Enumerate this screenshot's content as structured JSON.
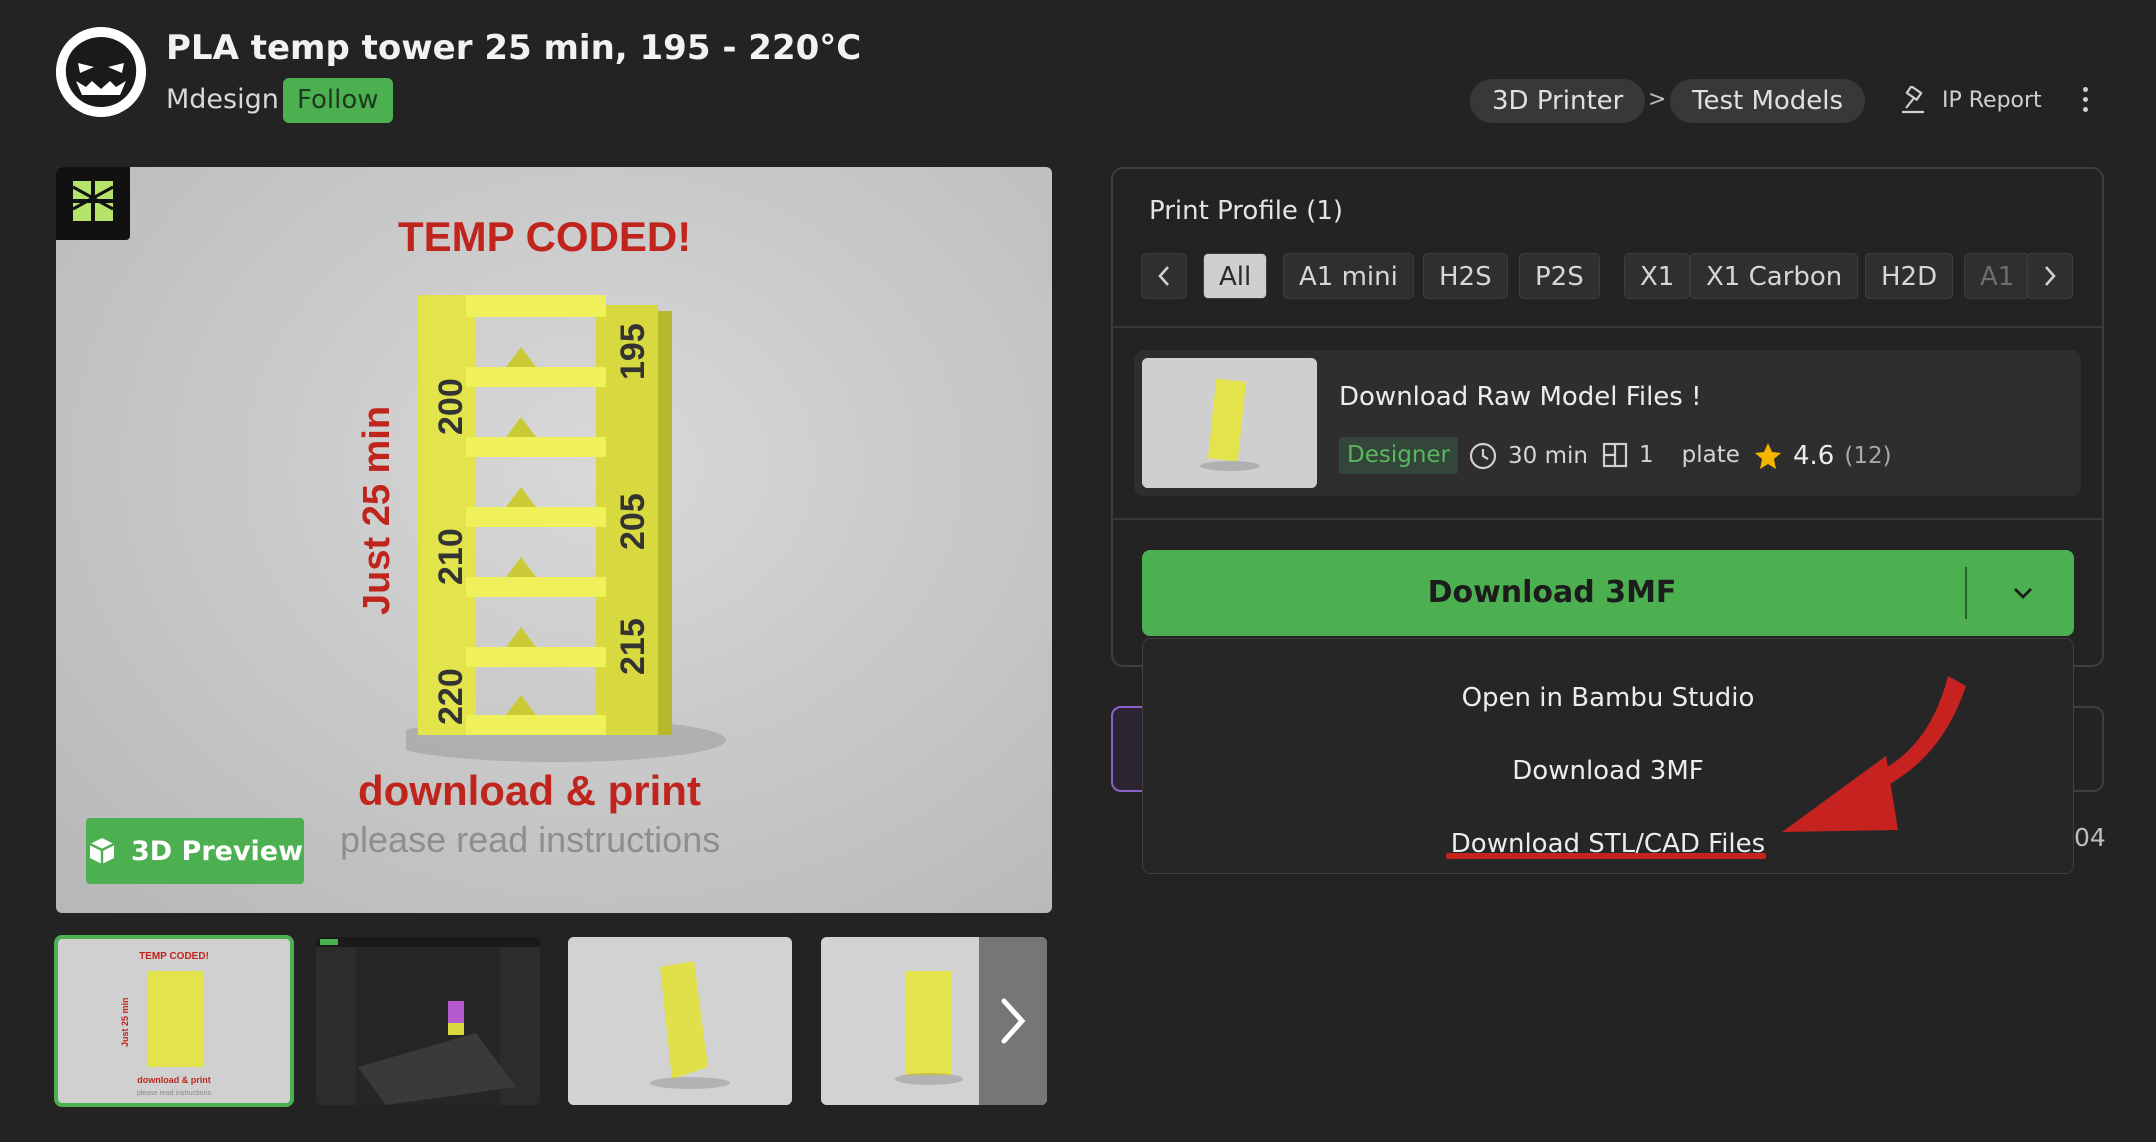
{
  "header": {
    "title": "PLA temp tower 25 min, 195 - 220°C",
    "author": "Mdesign",
    "follow_label": "Follow",
    "breadcrumbs": [
      "3D Printer",
      "Test Models"
    ],
    "breadcrumb_separator": ">",
    "ip_report_label": "IP Report"
  },
  "gallery": {
    "main_image_text": {
      "headline": "TEMP CODED!",
      "side_text": "Just 25 min",
      "bottom_line1": "download & print",
      "bottom_line2": "please read instructions",
      "tower_labels": [
        "195",
        "200",
        "205",
        "210",
        "215",
        "220"
      ]
    },
    "preview_button_label": "3D Preview",
    "thumbnails": [
      {
        "name": "thumb-temp-tower",
        "active": true
      },
      {
        "name": "thumb-slicer-screenshot",
        "active": false
      },
      {
        "name": "thumb-tower-angle",
        "active": false
      },
      {
        "name": "thumb-tower-overhang",
        "active": false
      }
    ],
    "thumb1_text": {
      "headline": "TEMP CODED!",
      "side_text": "Just 25 min",
      "bottom_line1": "download & print",
      "bottom_line2": "please read instructions"
    }
  },
  "print_profile": {
    "title": "Print Profile (1)",
    "filters": [
      "All",
      "A1 mini",
      "H2S",
      "P2S",
      "X1",
      "X1 Carbon",
      "H2D",
      "A1"
    ],
    "active_filter": "All",
    "card": {
      "title": "Download Raw Model Files !",
      "badge": "Designer",
      "time": "30 min",
      "plates_count": "1",
      "plates_label": "plate",
      "rating": "4.6",
      "rating_count": "(12)"
    }
  },
  "download": {
    "primary_label": "Download 3MF",
    "menu_items": [
      "Open in Bambu Studio",
      "Download 3MF",
      "Download STL/CAD Files"
    ],
    "highlighted_item": "Download STL/CAD Files"
  },
  "partial_text": "04",
  "colors": {
    "background": "#232323",
    "accent_green": "#4caf50",
    "annotation_red": "#c62320",
    "purple_border": "#8a63c9"
  }
}
